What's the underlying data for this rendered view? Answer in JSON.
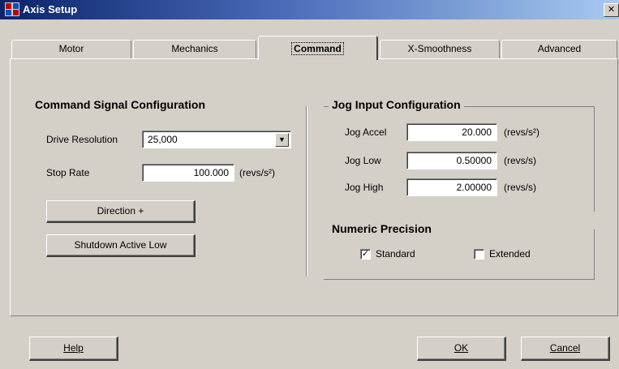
{
  "window": {
    "title": "Axis Setup",
    "close_glyph": "✕"
  },
  "tabs": [
    {
      "label": "Motor",
      "active": false
    },
    {
      "label": "Mechanics",
      "active": false
    },
    {
      "label": "Command",
      "active": true
    },
    {
      "label": "X-Smoothness",
      "active": false
    },
    {
      "label": "Advanced",
      "active": false
    }
  ],
  "command_signal": {
    "title": "Command Signal Configuration",
    "drive_resolution_label": "Drive Resolution",
    "drive_resolution_value": "25,000",
    "stop_rate_label": "Stop Rate",
    "stop_rate_value": "100.000",
    "stop_rate_unit": "(revs/s²)",
    "direction_button": "Direction +",
    "shutdown_button": "Shutdown Active Low"
  },
  "jog_input": {
    "title": "Jog Input Configuration",
    "rows": [
      {
        "label": "Jog Accel",
        "value": "20.000",
        "unit": "(revs/s²)"
      },
      {
        "label": "Jog Low",
        "value": "0.50000",
        "unit": "(revs/s)"
      },
      {
        "label": "Jog High",
        "value": "2.00000",
        "unit": "(revs/s)"
      }
    ]
  },
  "numeric_precision": {
    "title": "Numeric Precision",
    "standard_label": "Standard",
    "standard_checked": true,
    "extended_label": "Extended",
    "extended_checked": false,
    "check_glyph": "✓"
  },
  "footer": {
    "help_label": "Help",
    "ok_label": "OK",
    "cancel_label": "Cancel"
  },
  "colors": {
    "title_bar_start": "#0a246a",
    "title_bar_end": "#a6caf0",
    "dialog_face": "#d4d0c8"
  }
}
